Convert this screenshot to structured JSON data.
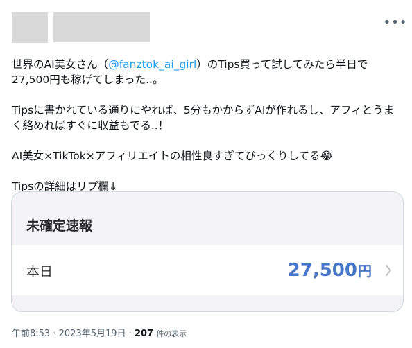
{
  "tweet": {
    "more_icon": "more-horizontal-icon",
    "line1_a": "世界のAI美女さん（",
    "mention": "@fanztok_ai_girl",
    "line1_b": "）のTips買って試してみたら半日で",
    "line1_c": "27,500円も稼げてしまった..。",
    "para2": "Tipsに書かれている通りにやれば、5分もかからずAIが作れるし、アフィとうまく絡めればすぐに収益もでる..！",
    "para3": "AI美女×TikTok×アフィリエイトの相性良すぎてびっくりしてる",
    "para3_emoji": "😂",
    "para4": "Tipsの詳細はリプ欄↓"
  },
  "card": {
    "header": "未確定速報",
    "row_label": "本日",
    "amount": "27,500",
    "unit": "円",
    "chevron_icon": "chevron-right-icon"
  },
  "meta": {
    "time": "午前8:53",
    "sep1": "·",
    "date": "2023年5月19日",
    "sep2": "·",
    "views": "207",
    "views_label": "件の表示"
  },
  "colors": {
    "link": "#1d9bf0",
    "amount": "#4a76c7",
    "placeholder": "#d9d9d9"
  }
}
